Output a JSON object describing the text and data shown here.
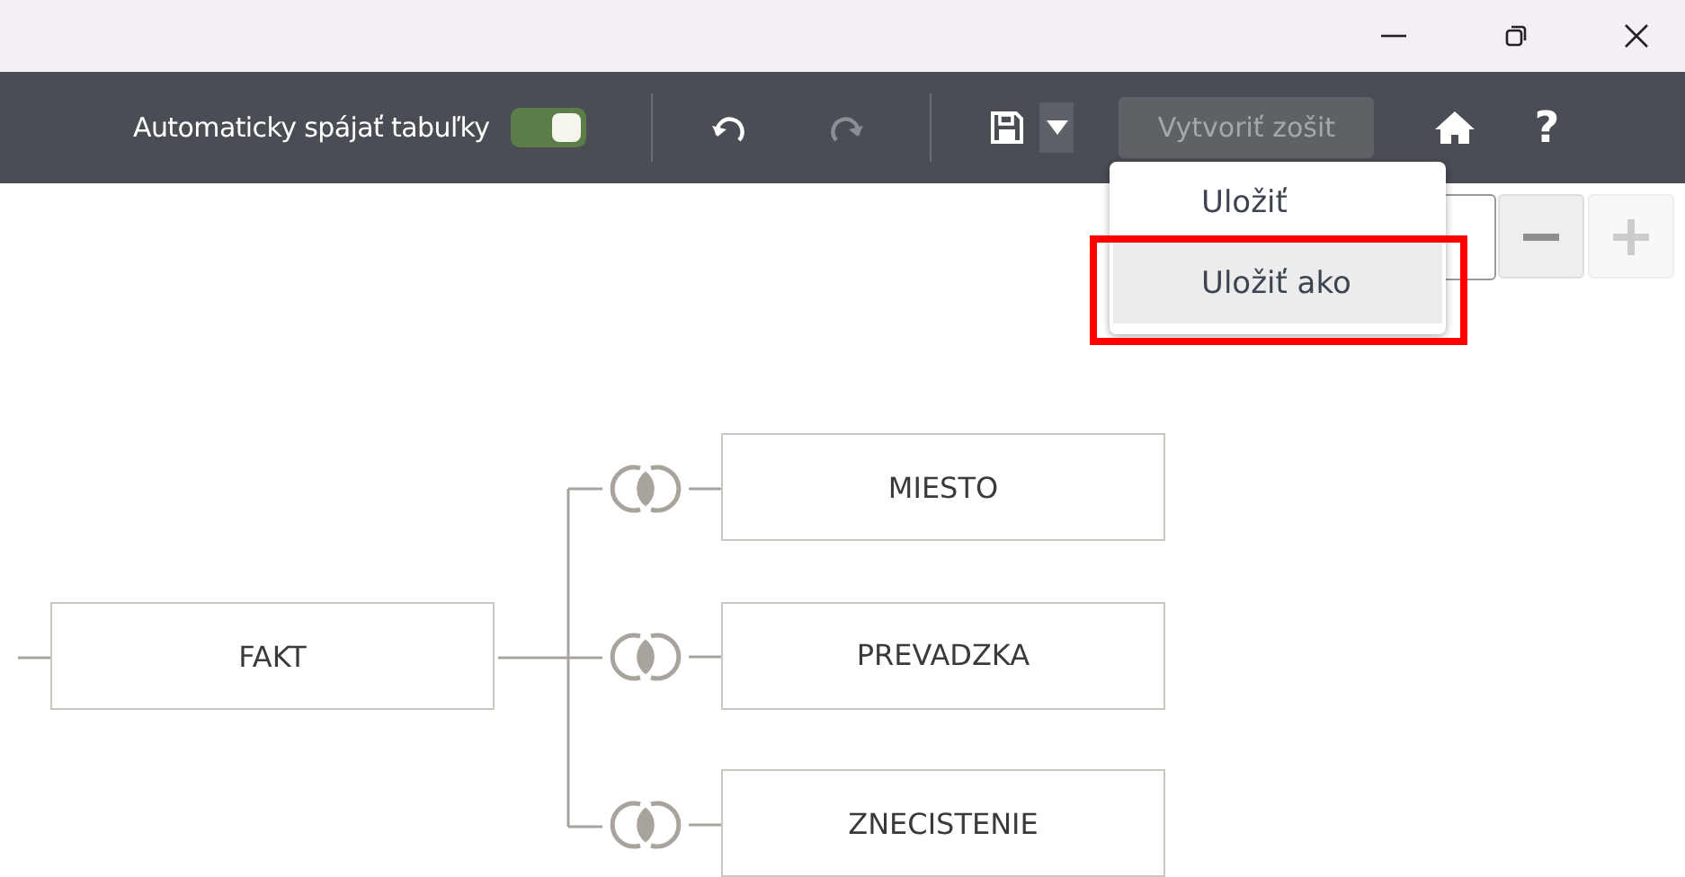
{
  "toolbar": {
    "auto_join": {
      "label": "Automaticky spájať tabuľky",
      "on": true
    },
    "undo": {
      "disabled": false
    },
    "redo": {
      "disabled": true
    },
    "create_workbook": {
      "label": "Vytvoriť zošit",
      "disabled": true
    },
    "help": {
      "label": "?"
    }
  },
  "save_menu": {
    "items": [
      {
        "label": "Uložiť",
        "selected": false
      },
      {
        "label": "Uložiť ako",
        "selected": true
      }
    ],
    "highlighted": true
  },
  "zoom": {
    "minus": {
      "disabled": false
    },
    "plus": {
      "disabled": true
    }
  },
  "diagram": {
    "root": {
      "label": "FAKT"
    },
    "children": [
      {
        "label": "MIESTO"
      },
      {
        "label": "PREVADZKA"
      },
      {
        "label": "ZNECISTENIE"
      }
    ]
  }
}
